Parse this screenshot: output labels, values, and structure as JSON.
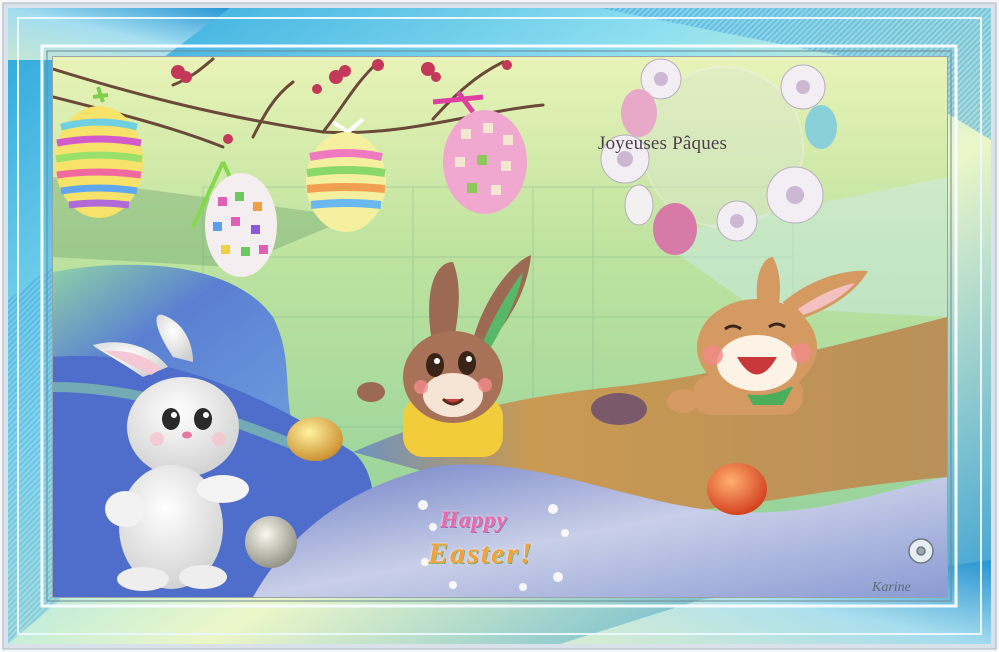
{
  "greeting_fr": "Joyeuses Pâques",
  "greeting_en_line1": "Happy",
  "greeting_en_line2": "Easter!",
  "signature": "Karine",
  "colors": {
    "frame_blue": "#2f9fd8",
    "frame_light": "#c8f0ea",
    "scene_green": "#a8d8a0",
    "water_blue": "#4d72c8",
    "sand": "#c99a52"
  }
}
